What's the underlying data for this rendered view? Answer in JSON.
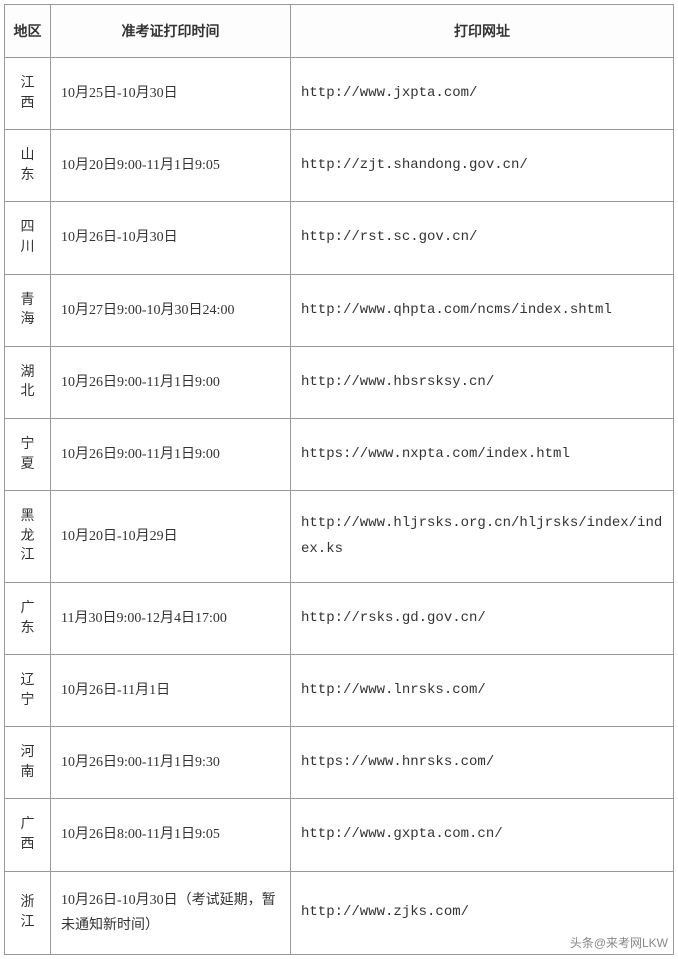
{
  "headers": {
    "region": "地区",
    "time": "准考证打印时间",
    "url": "打印网址"
  },
  "rows": [
    {
      "region": "江西",
      "time": "10月25日-10月30日",
      "url": "http://www.jxpta.com/"
    },
    {
      "region": "山东",
      "time": "10月20日9:00-11月1日9:05",
      "url": "http://zjt.shandong.gov.cn/"
    },
    {
      "region": "四川",
      "time": "10月26日-10月30日",
      "url": "http://rst.sc.gov.cn/"
    },
    {
      "region": "青海",
      "time": "10月27日9:00-10月30日24:00",
      "url": "http://www.qhpta.com/ncms/index.shtml"
    },
    {
      "region": "湖北",
      "time": "10月26日9:00-11月1日9:00",
      "url": "http://www.hbsrsksy.cn/"
    },
    {
      "region": "宁夏",
      "time": "10月26日9:00-11月1日9:00",
      "url": "https://www.nxpta.com/index.html"
    },
    {
      "region": "黑龙江",
      "time": "10月20日-10月29日",
      "url": "http://www.hljrsks.org.cn/hljrsks/index/index.ks"
    },
    {
      "region": "广东",
      "time": "11月30日9:00-12月4日17:00",
      "url": "http://rsks.gd.gov.cn/"
    },
    {
      "region": "辽宁",
      "time": "10月26日-11月1日",
      "url": "http://www.lnrsks.com/"
    },
    {
      "region": "河南",
      "time": "10月26日9:00-11月1日9:30",
      "url": "https://www.hnrsks.com/"
    },
    {
      "region": "广西",
      "time": "10月26日8:00-11月1日9:05",
      "url": "http://www.gxpta.com.cn/"
    },
    {
      "region": "浙江",
      "time": "10月26日-10月30日（考试延期，暂未通知新时间）",
      "url": "http://www.zjks.com/"
    }
  ],
  "watermark": "头条@来考网LKW"
}
